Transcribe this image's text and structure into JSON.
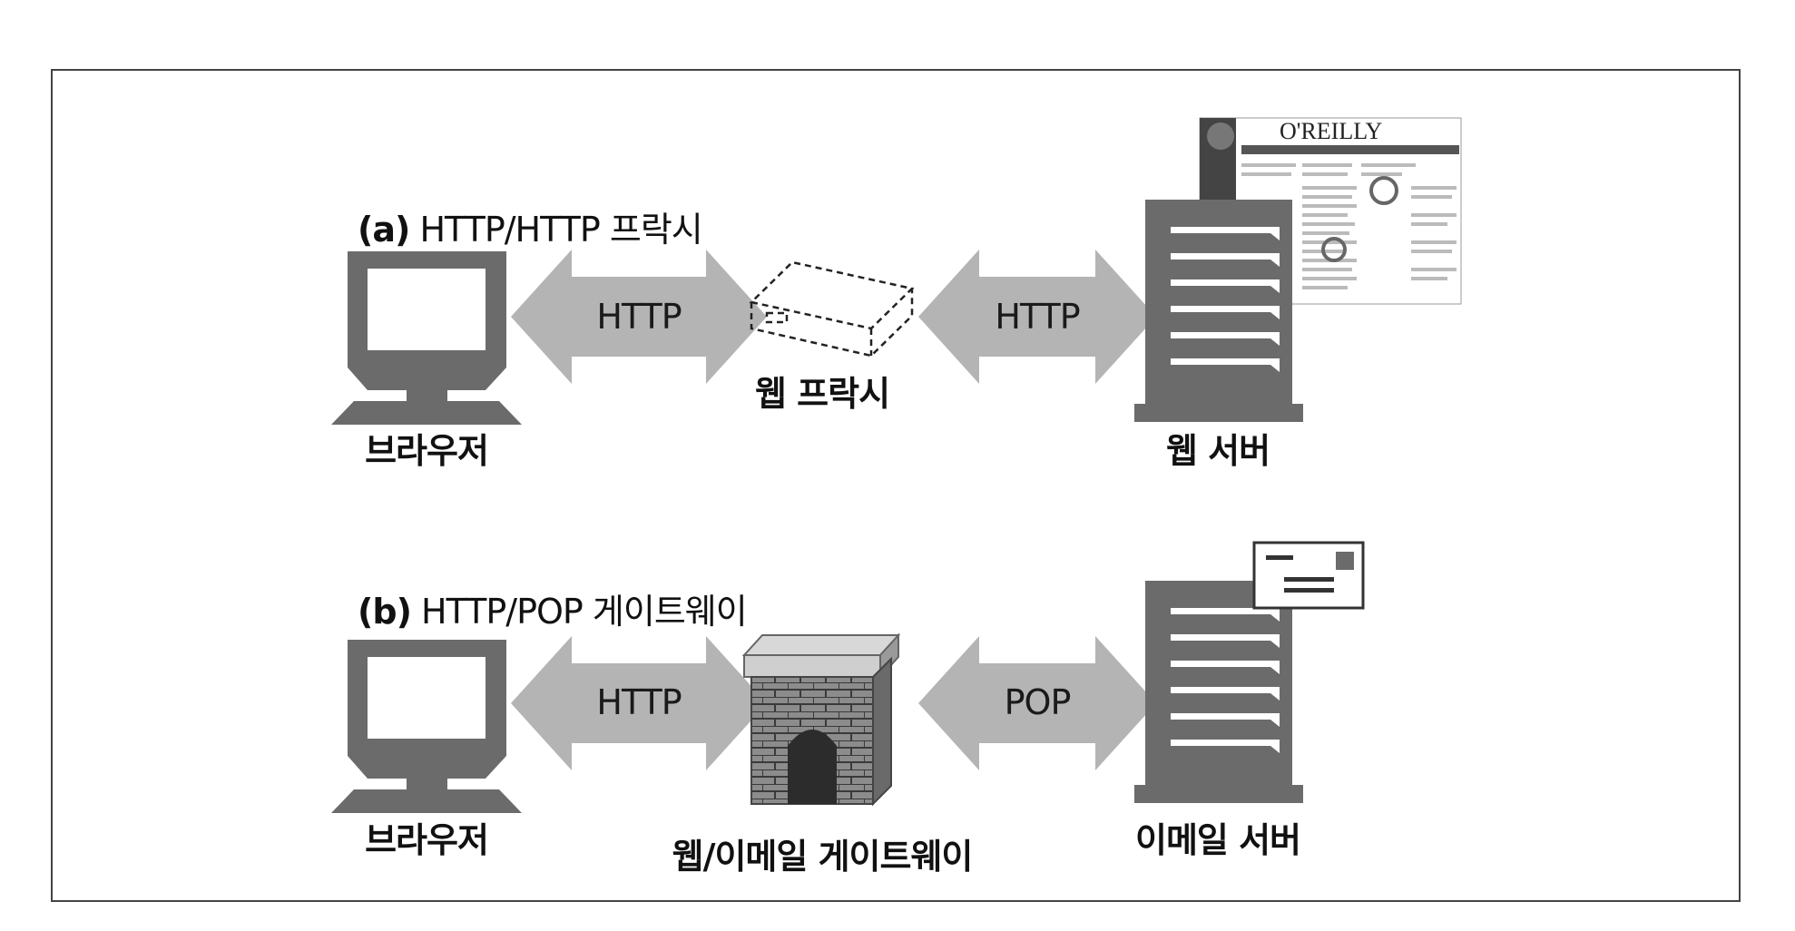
{
  "sections": [
    {
      "prefix": "(a)",
      "title": "HTTP/HTTP 프락시",
      "left_node": "브라우저",
      "middle_node": "웹 프락시",
      "right_node": "웹 서버",
      "left_arrow": "HTTP",
      "right_arrow": "HTTP"
    },
    {
      "prefix": "(b)",
      "title": "HTTP/POP 게이트웨이",
      "left_node": "브라우저",
      "middle_node": "웹/이메일 게이트웨이",
      "right_node": "이메일 서버",
      "left_arrow": "HTTP",
      "right_arrow": "POP"
    }
  ],
  "webpage_logo": "O'REILLY",
  "icons": [
    "computer-monitor-icon",
    "proxy-box-icon",
    "server-tower-icon",
    "web-page-icon",
    "brick-gateway-icon",
    "envelope-icon"
  ],
  "colors": {
    "arrow": "#b4b4b4",
    "device": "#6b6b6b",
    "border": "#444444"
  }
}
